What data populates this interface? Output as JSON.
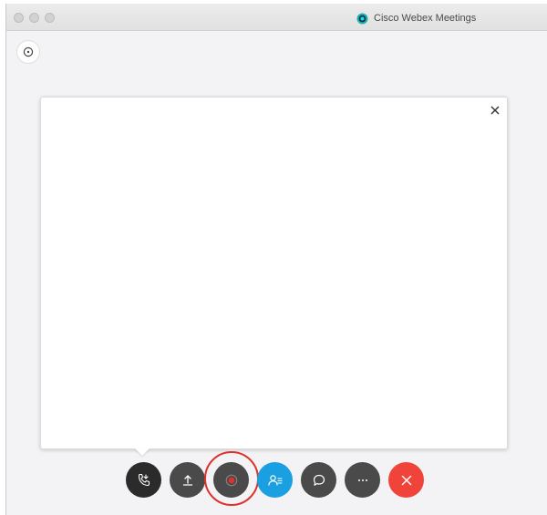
{
  "window": {
    "title": "Cisco Webex Meetings"
  },
  "icons": {
    "app_logo": "webex-logo-icon",
    "corner": "info-icon",
    "close": "close-icon",
    "audio": "phone-audio-icon",
    "share": "share-upload-icon",
    "record": "record-icon",
    "participants": "participants-icon",
    "chat": "chat-bubble-icon",
    "more": "more-options-icon",
    "end": "end-meeting-icon"
  },
  "colors": {
    "audio_button": "#2b2b2b",
    "dark_button": "#4a4a4a",
    "participants_button": "#1a9fe0",
    "end_button": "#f0433a",
    "record_dot": "#e0302c",
    "record_highlight": "#e0302c"
  }
}
